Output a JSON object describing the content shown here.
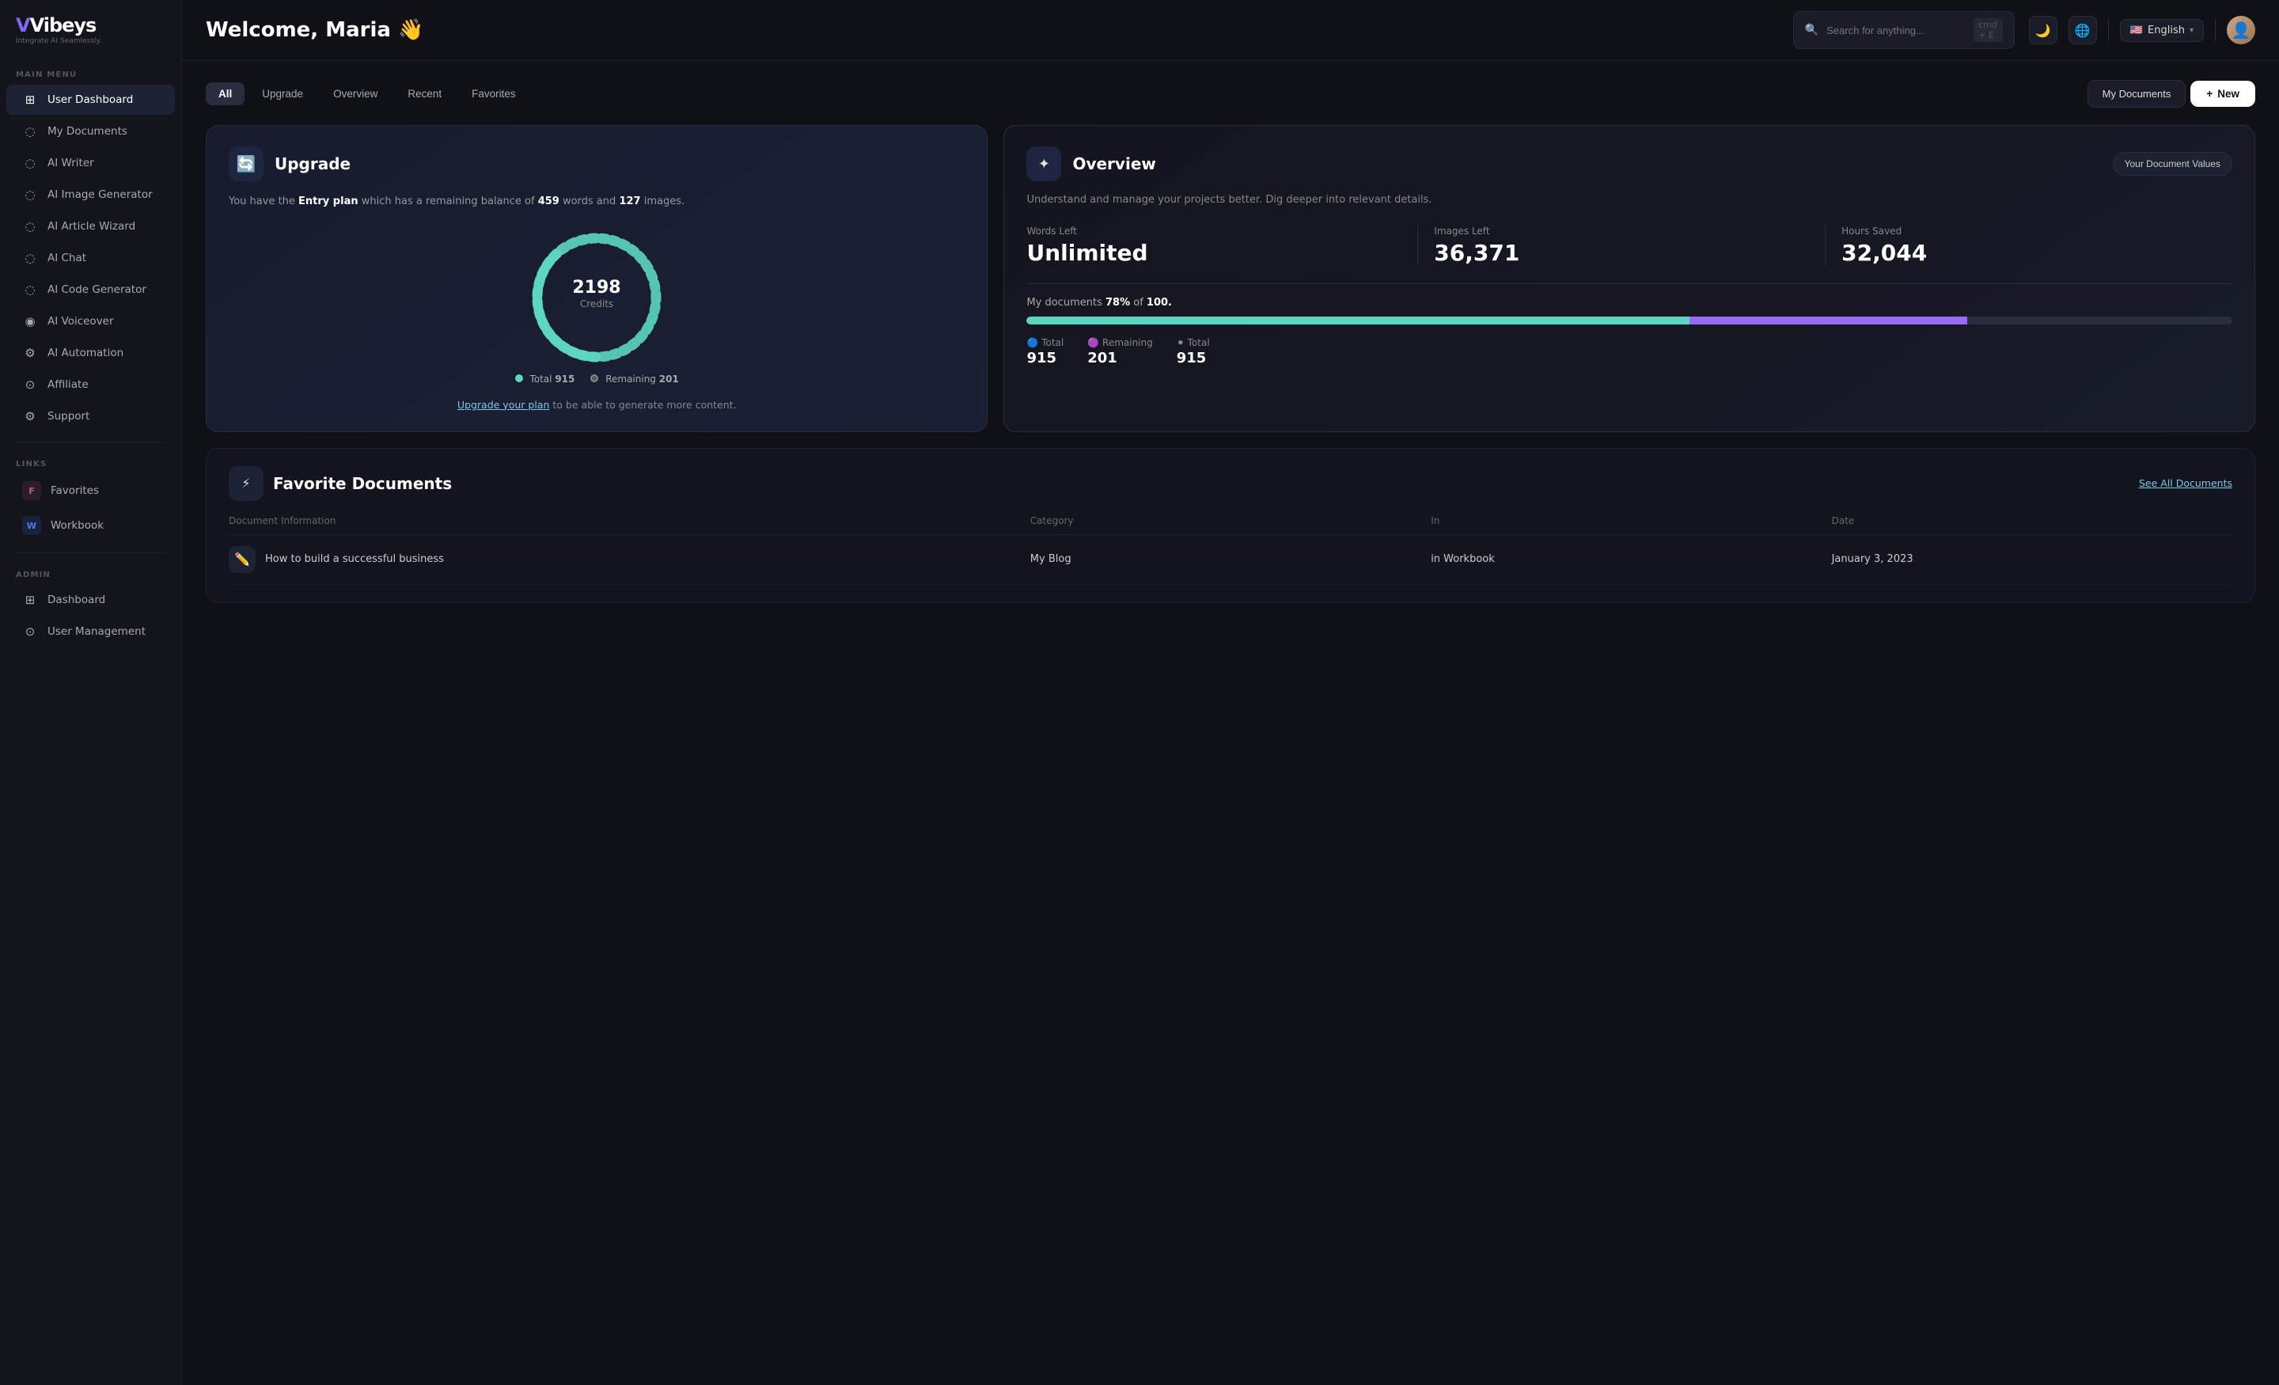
{
  "app": {
    "name": "Vibeys",
    "tagline": "Integrate AI Seamlessly.",
    "logo_initial": "V"
  },
  "header": {
    "greeting": "Welcome, Maria 👋",
    "search_placeholder": "Search for anything...",
    "search_shortcut": "cmd + E",
    "language": "English",
    "language_flag": "🇺🇸"
  },
  "sidebar": {
    "main_menu_label": "MAIN MENU",
    "items": [
      {
        "id": "user-dashboard",
        "label": "User Dashboard",
        "icon": "⊞",
        "active": true
      },
      {
        "id": "my-documents",
        "label": "My Documents",
        "icon": "⊙"
      },
      {
        "id": "ai-writer",
        "label": "AI Writer",
        "icon": "⊙"
      },
      {
        "id": "ai-image-generator",
        "label": "AI Image Generator",
        "icon": "⊙"
      },
      {
        "id": "ai-article-wizard",
        "label": "AI Article Wizard",
        "icon": "⊙"
      },
      {
        "id": "ai-chat",
        "label": "AI Chat",
        "icon": "⊙"
      },
      {
        "id": "ai-code-generator",
        "label": "AI Code Generator",
        "icon": "⊙"
      },
      {
        "id": "ai-voiceover",
        "label": "AI Voiceover",
        "icon": "◉"
      },
      {
        "id": "ai-automation",
        "label": "AI Automation",
        "icon": "⚙"
      },
      {
        "id": "affiliate",
        "label": "Affiliate",
        "icon": "⊙"
      },
      {
        "id": "support",
        "label": "Support",
        "icon": "⚙"
      }
    ],
    "links_label": "LINKS",
    "links": [
      {
        "id": "favorites",
        "label": "Favorites",
        "badge_letter": "F",
        "badge_color": "#c45c8a"
      },
      {
        "id": "workbook",
        "label": "Workbook",
        "badge_letter": "W",
        "badge_color": "#4a7cf5"
      }
    ],
    "admin_label": "ADMIN",
    "admin_items": [
      {
        "id": "dashboard",
        "label": "Dashboard",
        "icon": "⊞"
      },
      {
        "id": "user-management",
        "label": "User Management",
        "icon": "⊙"
      }
    ]
  },
  "tabs": {
    "items": [
      {
        "id": "all",
        "label": "All",
        "active": true
      },
      {
        "id": "upgrade",
        "label": "Upgrade"
      },
      {
        "id": "overview",
        "label": "Overview"
      },
      {
        "id": "recent",
        "label": "Recent"
      },
      {
        "id": "favorites",
        "label": "Favorites"
      }
    ],
    "my_documents_label": "My Documents",
    "new_label": "+ New"
  },
  "upgrade_card": {
    "icon": "🔄",
    "title": "Upgrade",
    "description_prefix": "You have the ",
    "plan_name": "Entry plan",
    "description_middle": " which has a remaining balance of ",
    "words_count": "459",
    "words_label": "words",
    "description_and": " and ",
    "images_count": "127",
    "images_label": "images.",
    "credits_value": "2198",
    "credits_label": "Credits",
    "legend_total_label": "Total",
    "legend_total_value": "915",
    "legend_remaining_label": "Remaining",
    "legend_remaining_value": "201",
    "upgrade_link_text": "Upgrade your plan",
    "upgrade_link_suffix": " to be able to generate more content."
  },
  "overview_card": {
    "icon": "✦",
    "title": "Overview",
    "your_doc_values_label": "Your Document Values",
    "description": "Understand and manage your projects better. Dig deeper into relevant details.",
    "stats": [
      {
        "label": "Words Left",
        "value": "Unlimited"
      },
      {
        "label": "Images Left",
        "value": "36,371"
      },
      {
        "label": "Hours Saved",
        "value": "32,044"
      }
    ],
    "docs_progress_prefix": "My documents ",
    "docs_progress_pct": "78%",
    "docs_progress_middle": " of ",
    "docs_progress_total": "100.",
    "progress_teal_pct": 55,
    "progress_purple_pct": 23,
    "legend": [
      {
        "label": "Total",
        "value": "915",
        "color": "#5dd6c0"
      },
      {
        "label": "Remaining",
        "value": "201",
        "color": "#9b6af5"
      },
      {
        "label": "Total",
        "value": "915",
        "color": "#555"
      }
    ]
  },
  "favorite_docs": {
    "icon": "★",
    "title": "Favorite Documents",
    "see_all_label": "See All Documents",
    "columns": [
      {
        "label": "Document Information"
      },
      {
        "label": "Category"
      },
      {
        "label": "In"
      },
      {
        "label": "Date"
      }
    ],
    "rows": [
      {
        "icon": "✏️",
        "title": "How to build a successful business",
        "category": "My Blog",
        "location": "in Workbook",
        "date": "January 3, 2023"
      }
    ]
  }
}
